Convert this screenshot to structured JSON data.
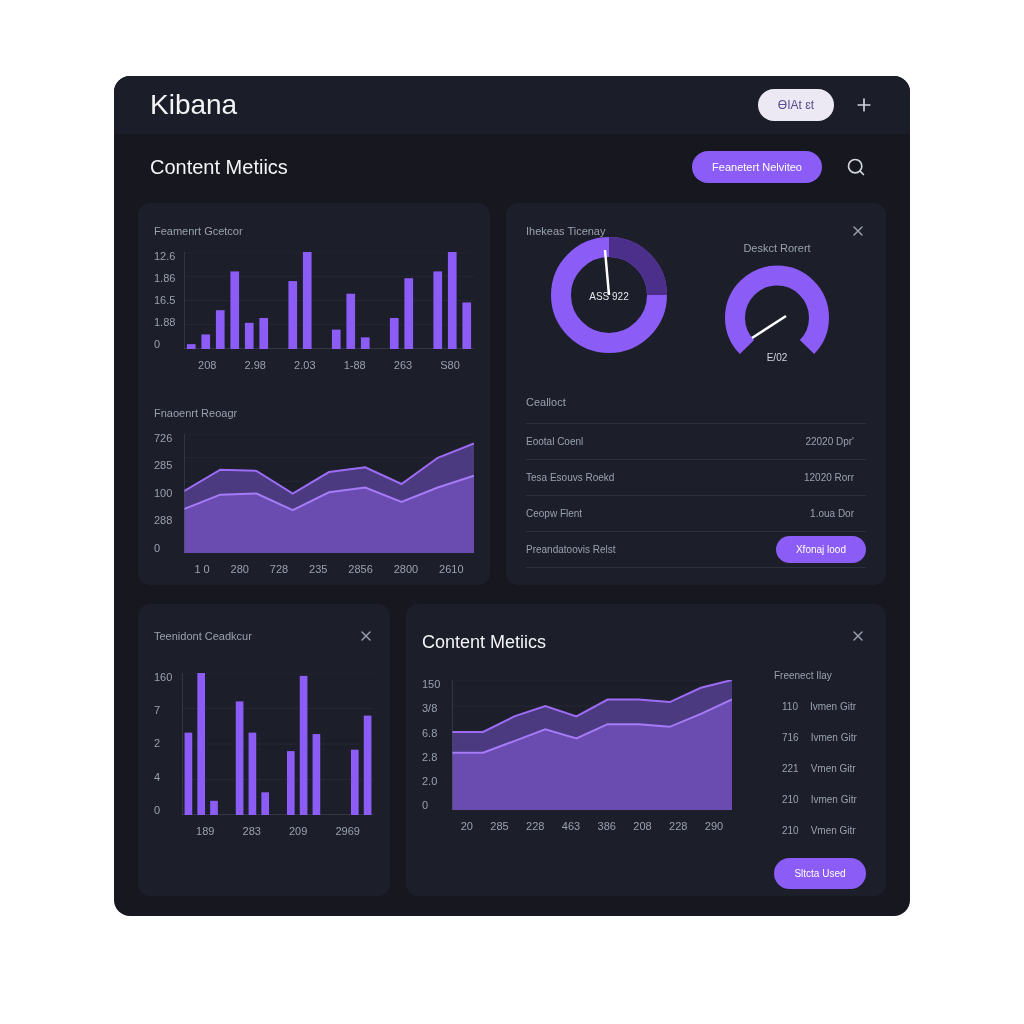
{
  "app": {
    "title": "Kibana",
    "pill_button": "ƟIAt ɛt"
  },
  "toolbar": {
    "title": "Content Metiics",
    "action_button": "Feanetert Nelviteo"
  },
  "panel_top_left": {
    "bar_chart": {
      "title": "Feamenrt Gcetcor",
      "y_labels": [
        "12.6",
        "1.86",
        "16.5",
        "1.88",
        "0"
      ],
      "x_labels": [
        "208",
        "2.98",
        "2.03",
        "1-88",
        "263",
        "S80"
      ]
    },
    "area_chart": {
      "title": "Fnaoenrt Reoagr",
      "y_labels": [
        "726",
        "285",
        "100",
        "288",
        "0"
      ],
      "x_labels": [
        "1 0",
        "280",
        "728",
        "235",
        "2856",
        "2800",
        "2610"
      ]
    }
  },
  "panel_top_right": {
    "gauge_1": {
      "title": "Ihekeas Ticenay",
      "reading": "ASS 922"
    },
    "gauge_2": {
      "title": "Deskct Rorert",
      "reading": "E/02"
    },
    "table": {
      "heading": "Cealloct",
      "rows": [
        {
          "label": "Eootal Coenl",
          "value": "22020 Dpr'"
        },
        {
          "label": "Tesa Esouvs Roekd",
          "value": "12020 Rorr"
        },
        {
          "label": "Ceopw Flent",
          "value": "1.oua Dor"
        }
      ],
      "footer_label": "Preandatoovis Relst",
      "footer_button": "Xfonaj lood"
    }
  },
  "panel_bottom_left": {
    "bar_chart": {
      "title": "Teenidont Ceadkcur",
      "y_labels": [
        "160",
        "7",
        "2",
        "4",
        "0"
      ],
      "x_labels": [
        "189",
        "283",
        "209",
        "2969"
      ]
    }
  },
  "panel_bottom_right": {
    "title": "Content Metiics",
    "area_chart": {
      "y_labels": [
        "150",
        "3/8",
        "6.8",
        "2.8",
        "2.0",
        "0"
      ],
      "x_labels": [
        "20",
        "285",
        "228",
        "463",
        "386",
        "208",
        "228",
        "290"
      ]
    },
    "legend": {
      "title": "Freenect Ilay",
      "items": [
        {
          "value": "110",
          "label": "Ivmen Gitr"
        },
        {
          "value": "716",
          "label": "Ivmen Gitr"
        },
        {
          "value": "221",
          "label": "Vmen Gitr"
        },
        {
          "value": "210",
          "label": "Ivmen Gitr"
        },
        {
          "value": "210",
          "label": "Vmen Gitr"
        }
      ]
    },
    "button": "Sltcta Used"
  }
}
